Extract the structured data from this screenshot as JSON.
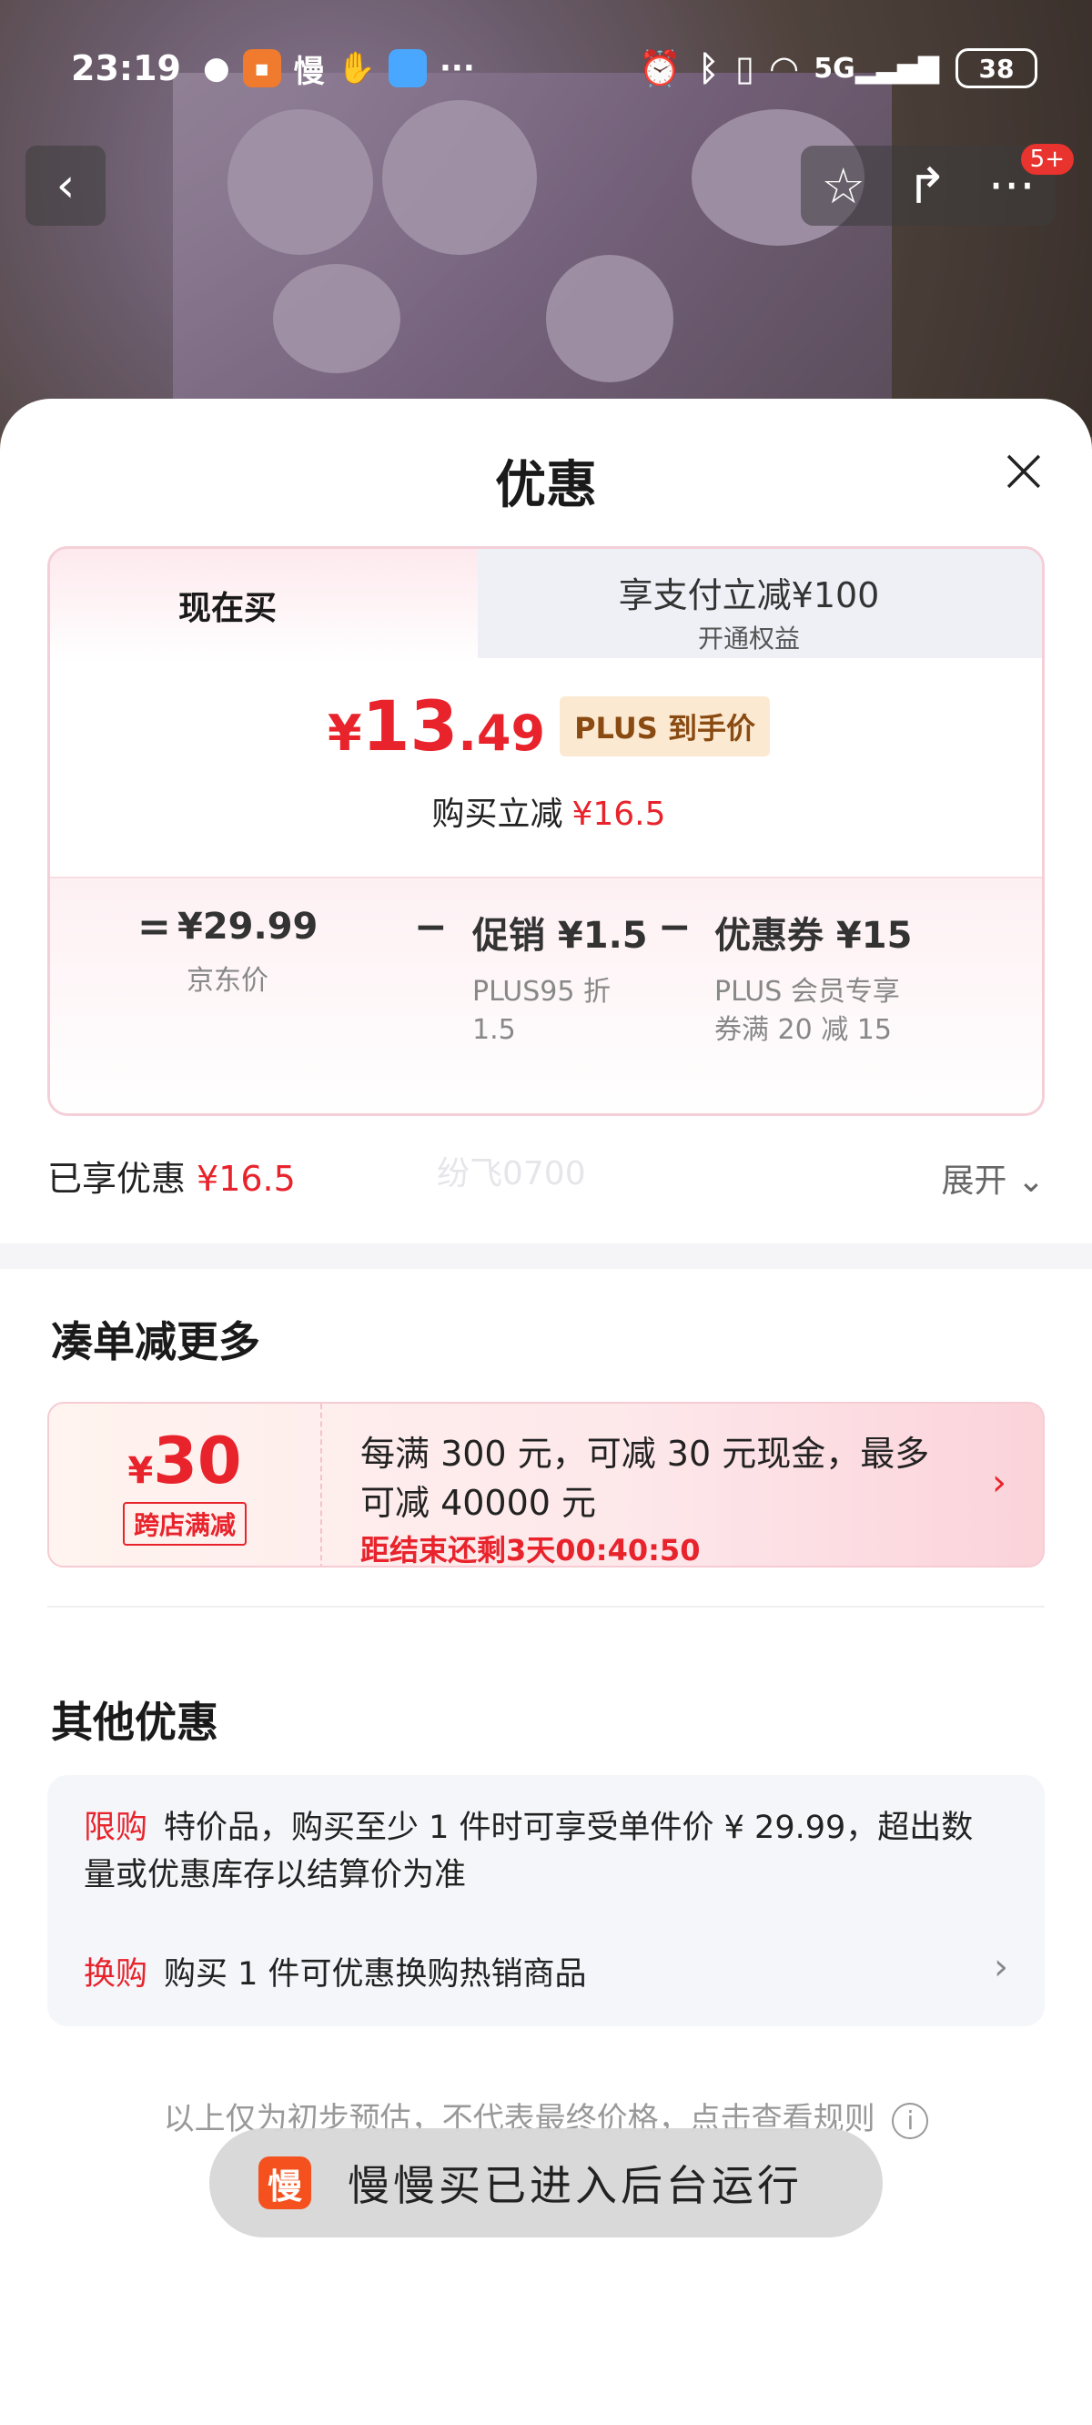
{
  "status_bar": {
    "time": "23:19",
    "icons": [
      "wechat-icon",
      "app-icon",
      "slow-buy-icon",
      "hand-icon",
      "weather-icon",
      "more-dots-icon",
      "alarm-icon",
      "bluetooth-icon",
      "vibrate-icon",
      "wifi-icon",
      "signal-5g-icon"
    ],
    "battery": "38"
  },
  "nav": {
    "badge": "5+"
  },
  "sheet": {
    "title": "优惠",
    "tabs": {
      "now": "现在买",
      "pay_title": "享支付立减¥100",
      "pay_sub": "开通权益"
    },
    "price": {
      "yen": "¥",
      "int": "13",
      "dec": ".49",
      "tag": "PLUS 到手价"
    },
    "reduce": {
      "label": "购买立减",
      "value": "¥16.5"
    },
    "breakdown": {
      "eq": "=",
      "minus": "−",
      "jd_price": "¥29.99",
      "jd_label": "京东价",
      "promo": "促销 ¥1.5",
      "promo_sub": "PLUS95 折 1.5",
      "coupon": "优惠券 ¥15",
      "coupon_sub": "PLUS 会员专享券满 20 减 15"
    },
    "enjoyed": {
      "label": "已享优惠",
      "value": "¥16.5"
    },
    "watermark": "纷飞0700",
    "expand": "展开"
  },
  "bundle": {
    "title": "凑单减更多",
    "amount_yen": "¥",
    "amount": "30",
    "tag": "跨店满减",
    "text": "每满 300 元，可减 30 元现金，最多可减 40000 元",
    "countdown": "距结束还剩3天00:40:50"
  },
  "other": {
    "title": "其他优惠",
    "limit_tag": "限购",
    "limit_text": "特价品，购买至少 1 件时可享受单件价 ¥ 29.99，超出数量或优惠库存以结算价为准",
    "swap_tag": "换购",
    "swap_text": "购买 1 件可优惠换购热销商品"
  },
  "footnote": "以上仅为初步预估，不代表最终价格，点击查看规则",
  "toast": {
    "icon": "慢",
    "text": "慢慢买已进入后台运行"
  }
}
